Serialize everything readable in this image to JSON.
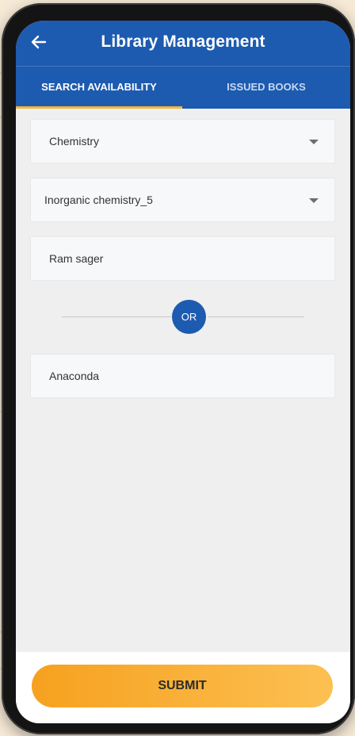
{
  "header": {
    "title": "Library Management",
    "back_icon": "arrow-left-icon"
  },
  "tabs": [
    {
      "label": "SEARCH AVAILABILITY",
      "active": true
    },
    {
      "label": "ISSUED BOOKS",
      "active": false
    }
  ],
  "form": {
    "subject_dropdown": {
      "value": "Chemistry",
      "icon": "caret-down-icon"
    },
    "book_dropdown": {
      "value": "Inorganic chemistry_5",
      "icon": "caret-down-icon"
    },
    "author_input": {
      "value": "Ram sager"
    },
    "separator_label": "OR",
    "title_input": {
      "value": "Anaconda"
    }
  },
  "footer": {
    "submit_label": "SUBMIT"
  },
  "colors": {
    "primary": "#1c5bb0",
    "accent": "#f4b63a",
    "button_gradient_start": "#f6a11f",
    "button_gradient_end": "#fcc052",
    "screen_background": "#efefef"
  }
}
